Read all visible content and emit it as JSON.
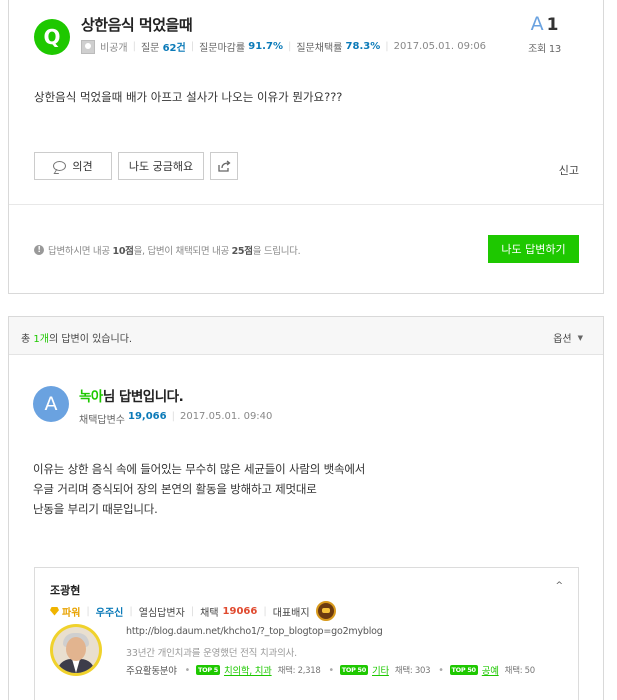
{
  "question": {
    "badge": "Q",
    "title": "상한음식 먹었을때",
    "author": "비공개",
    "questions_label": "질문",
    "questions_count": "62건",
    "close_rate_label": "질문마감률",
    "close_rate": "91.7%",
    "adopt_rate_label": "질문채택률",
    "adopt_rate": "78.3%",
    "datetime": "2017.05.01. 09:06",
    "answer_letter": "A",
    "answer_count": "1",
    "views_label": "조회",
    "views": "13",
    "body": "상한음식 먹었을때 배가 아프고 설사가 나오는 이유가 뭔가요???",
    "buttons": {
      "opinion": "의견",
      "curious": "나도 궁금해요"
    },
    "report": "신고",
    "notice": {
      "icon": "!",
      "text1": "답변하시면 내공",
      "points1": "10점",
      "text2": "을, 답변이 채택되면 내공",
      "points2": "25점",
      "text3": "을 드립니다."
    },
    "answer_button": "나도 답변하기"
  },
  "answers": {
    "total_prefix": "총",
    "total_count": "1개",
    "total_suffix": "의 답변이 있습니다.",
    "options": "옵션",
    "options_caret": "▼",
    "item": {
      "avatar": "A",
      "name": "녹아",
      "title_suffix": "님 답변입니다.",
      "adopted_label": "채택답변수",
      "adopted_count": "19,066",
      "datetime": "2017.05.01. 09:40",
      "body_lines": [
        "이유는 상한 음식 속에 들어있는 무수히 많은 세균들이 사람의 뱃속에서",
        "우글 거리며 증식되어 장의 본연의 활동을 방해하고 제멋대로",
        "난동을 부리기 때문입니다."
      ]
    }
  },
  "profile": {
    "name": "조광현",
    "collapse": "^",
    "power_label": "파워",
    "grade": "우주신",
    "answerer_type": "열심답변자",
    "adopt_label": "채택",
    "adopt_count": "19066",
    "badge_label": "대표배지",
    "url": "http://blog.daum.net/khcho1/?_top_blogtop=go2myblog",
    "intro": "33년간 개인치과를 운영했던 전직 치과의사.",
    "fields_label": "주요활동분야",
    "fields": [
      {
        "rank": "TOP 5",
        "name": "치의학, 치과",
        "count": "채택: 2,318"
      },
      {
        "rank": "TOP 50",
        "name": "기타",
        "count": "채택: 303"
      },
      {
        "rank": "TOP 50",
        "name": "공예",
        "count": "채택: 50"
      }
    ]
  }
}
